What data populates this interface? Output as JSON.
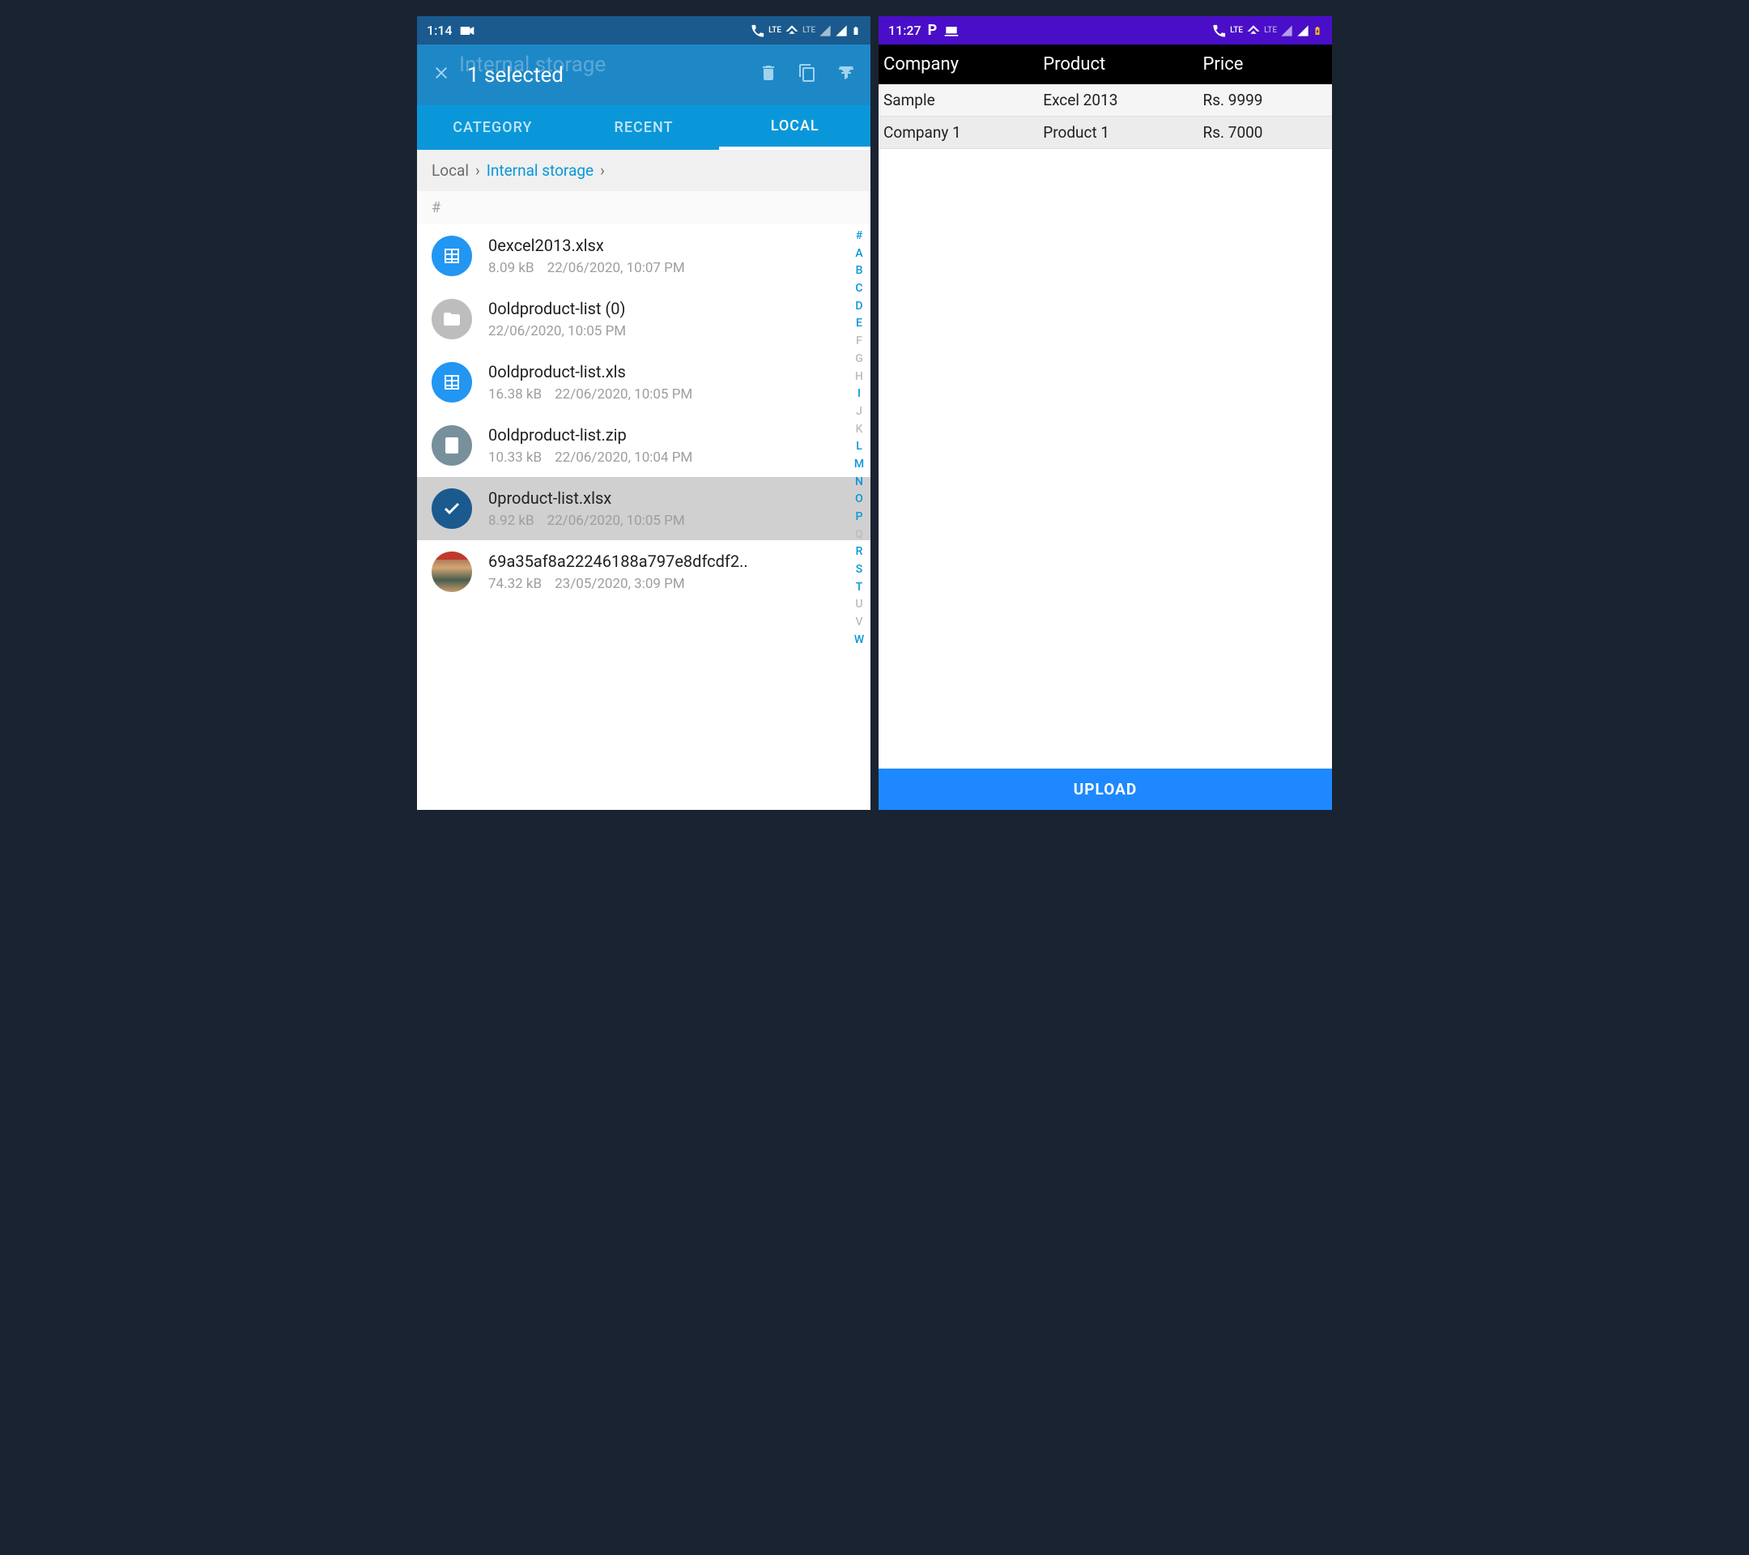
{
  "left": {
    "status": {
      "time": "1:14"
    },
    "appbar": {
      "title_bg": "Internal storage",
      "title_fg": "1 selected"
    },
    "tabs": {
      "category": "CATEGORY",
      "recent": "RECENT",
      "local": "LOCAL"
    },
    "breadcrumb": {
      "root": "Local",
      "current": "Internal storage"
    },
    "section": "#",
    "files": [
      {
        "name": "0excel2013.xlsx",
        "size": "8.09 kB",
        "date": "22/06/2020, 10:07 PM"
      },
      {
        "name": "0oldproduct-list (0)",
        "size": "",
        "date": "22/06/2020, 10:05 PM"
      },
      {
        "name": "0oldproduct-list.xls",
        "size": "16.38 kB",
        "date": "22/06/2020, 10:05 PM"
      },
      {
        "name": "0oldproduct-list.zip",
        "size": "10.33 kB",
        "date": "22/06/2020, 10:04 PM"
      },
      {
        "name": "0product-list.xlsx",
        "size": "8.92 kB",
        "date": "22/06/2020, 10:05 PM"
      },
      {
        "name": "69a35af8a22246188a797e8dfcdf2..",
        "size": "74.32 kB",
        "date": "23/05/2020, 3:09 PM"
      }
    ],
    "alpha": [
      "#",
      "A",
      "B",
      "C",
      "D",
      "E",
      "F",
      "G",
      "H",
      "I",
      "J",
      "K",
      "L",
      "M",
      "N",
      "O",
      "P",
      "Q",
      "R",
      "S",
      "T",
      "U",
      "V",
      "W"
    ]
  },
  "right": {
    "status": {
      "time": "11:27"
    },
    "headers": {
      "company": "Company",
      "product": "Product",
      "price": "Price"
    },
    "rows": [
      {
        "company": "Sample",
        "product": "Excel 2013",
        "price": "Rs. 9999"
      },
      {
        "company": "Company 1",
        "product": "Product 1",
        "price": "Rs. 7000"
      }
    ],
    "upload": "UPLOAD"
  }
}
